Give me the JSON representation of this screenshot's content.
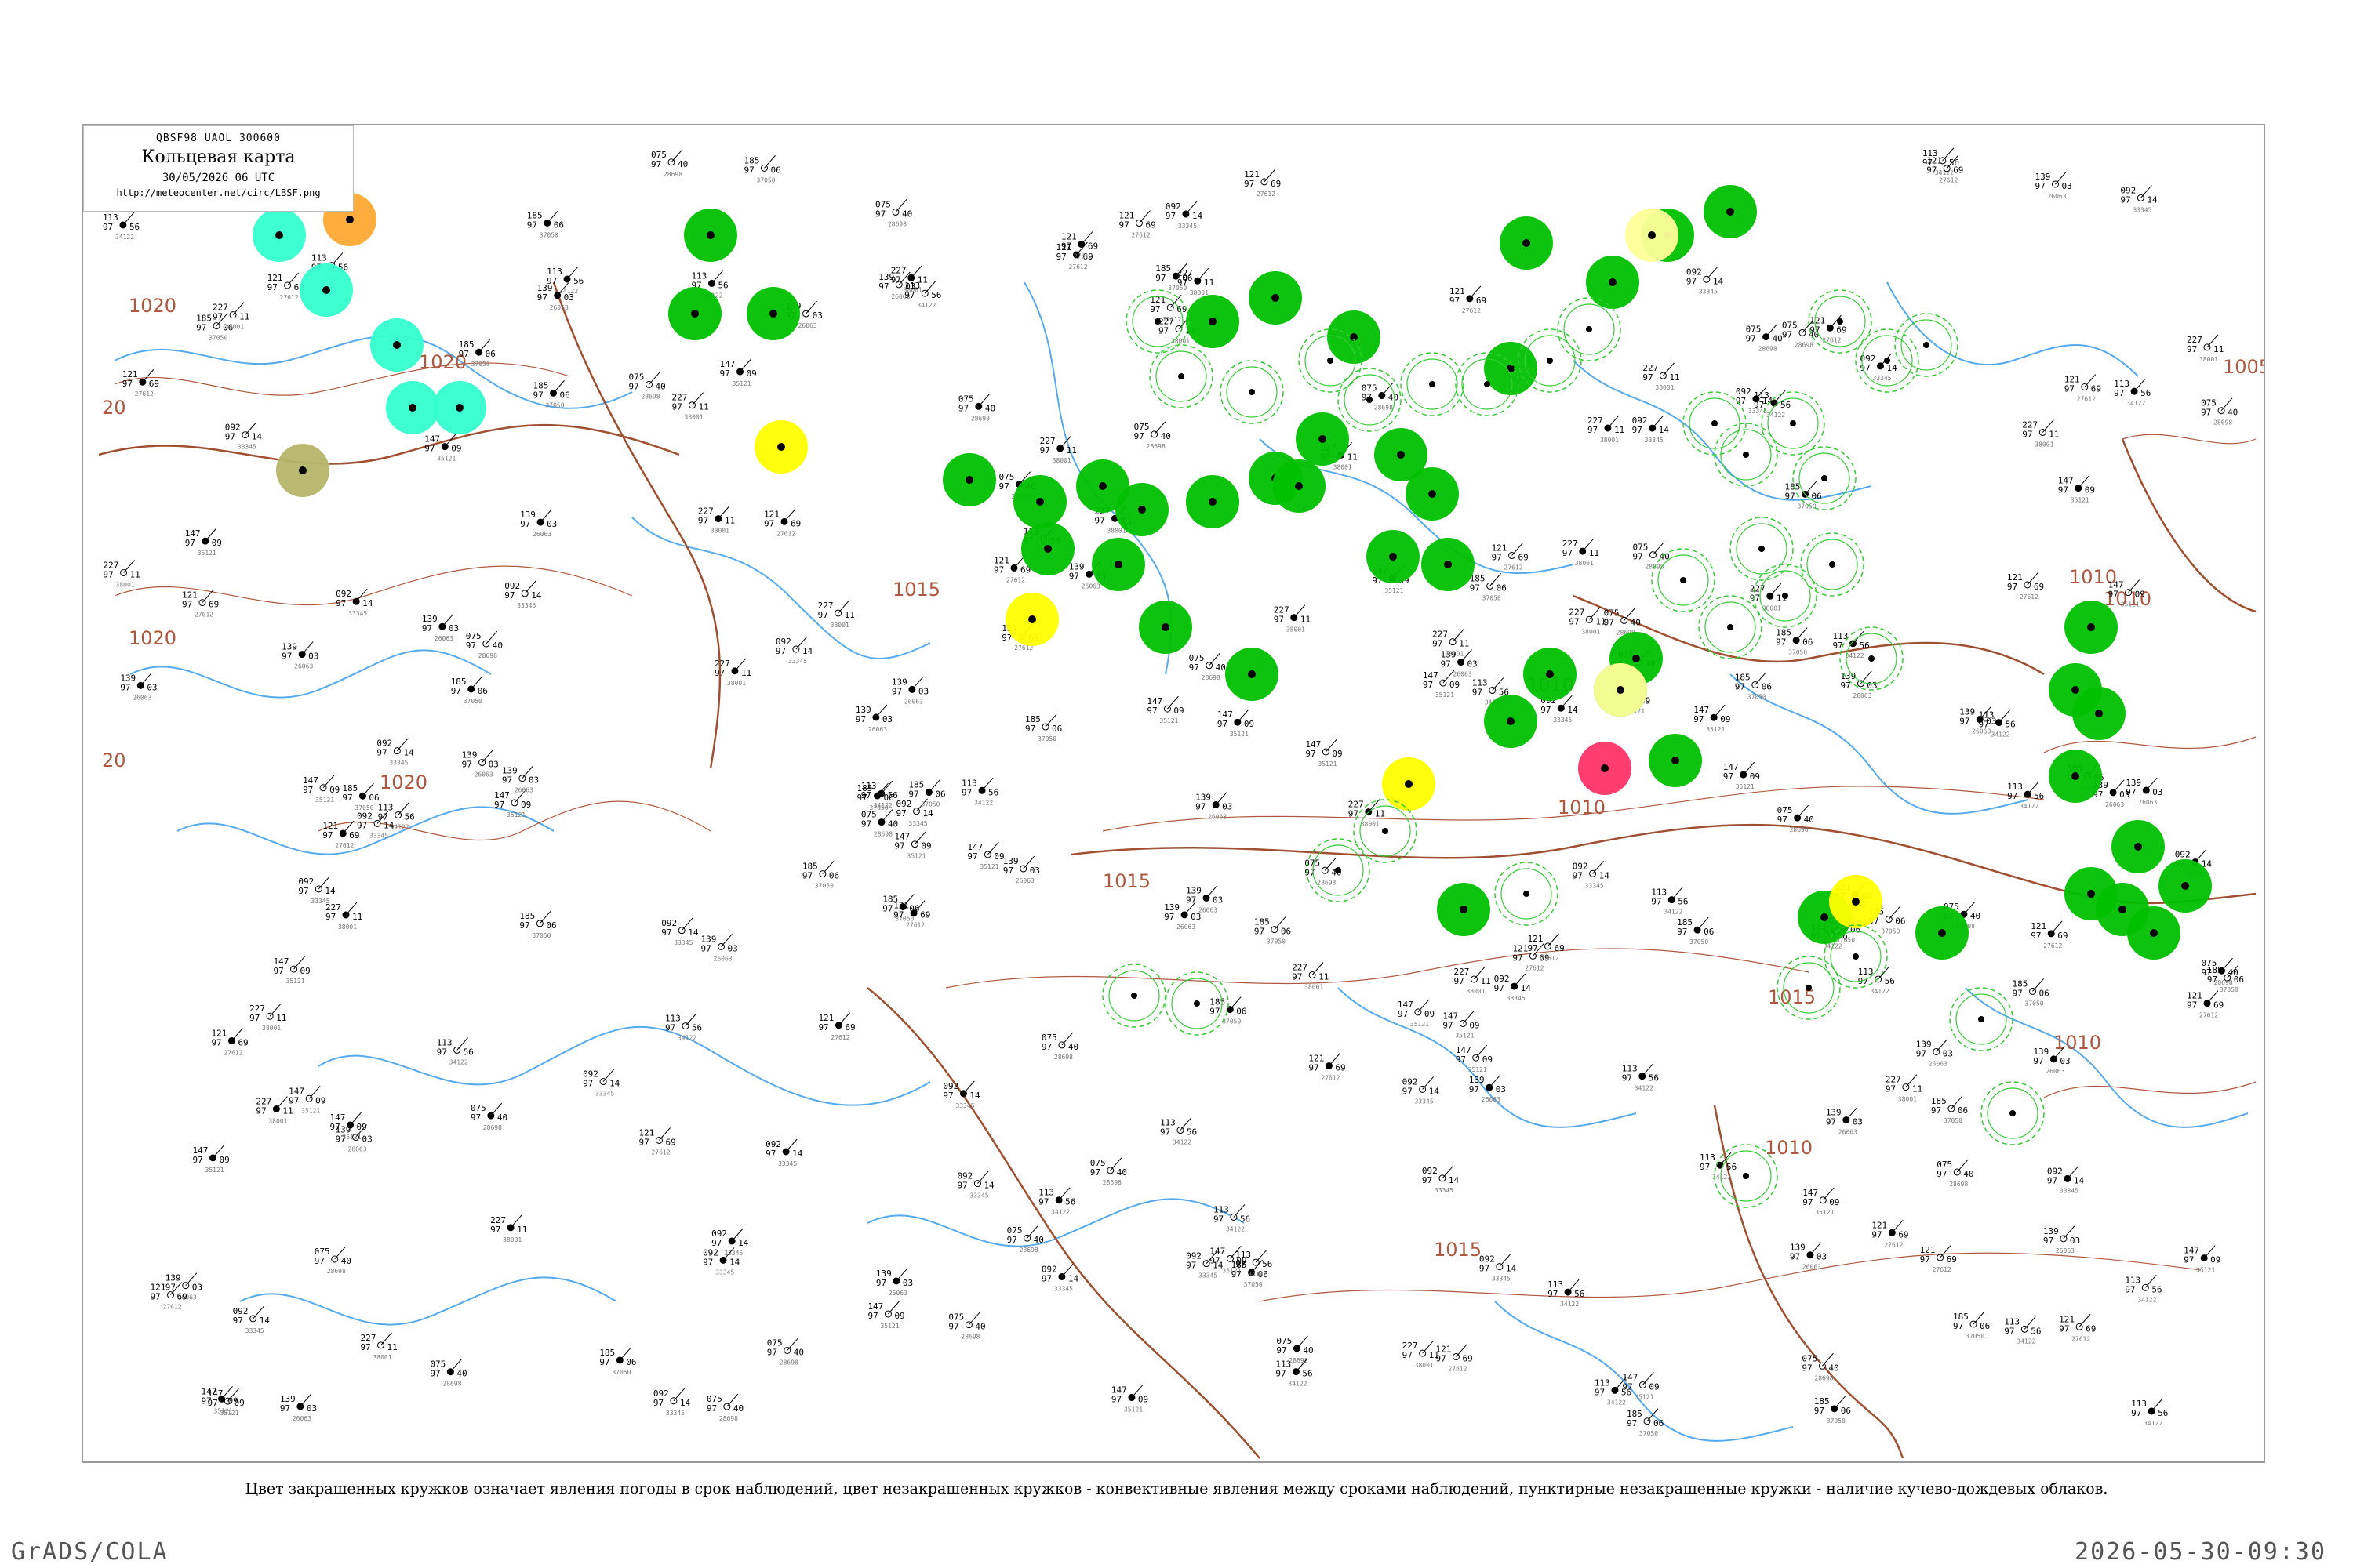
{
  "header": {
    "code": "QBSF98  UAOL  300600",
    "title": "Кольцевая карта",
    "datetime": "30/05/2026 06 UTC",
    "url": "http://meteocenter.net/circ/LBSF.png"
  },
  "caption": "Цвет закрашенных кружков означает явления погоды в срок наблюдений, цвет незакрашенных кружков - конвективные явления между сроками наблюдений, пунктирные незакрашенные кружки - наличие кучево-дождевых облаков.",
  "footer": {
    "left": "GrADS/COLA",
    "right": "2026-05-30-09:30"
  },
  "colors": {
    "green": "#00c000",
    "yellow": "#ffff00",
    "red": "#ff3366",
    "cyan": "#33ffcc",
    "orange": "#ffaa33",
    "olive": "#b5b56a",
    "pale_yellow": "#ffff99",
    "isobar": "#b0573f",
    "border": "#a05030",
    "water": "#55aaee"
  },
  "isobar_labels": [
    "1020",
    "1020",
    "1020",
    "1020",
    "20",
    "20",
    "1010",
    "1010",
    "1010",
    "1010",
    "1010",
    "1015",
    "1015",
    "1015",
    "1015",
    "1005",
    "1010"
  ],
  "filled_circles_green": 44,
  "filled_circles_yellow": 4,
  "filled_circles_red": 1,
  "filled_circles_cyan": 5,
  "filled_circles_orange": 1,
  "filled_circles_olive": 1,
  "stations_sample": [
    {
      "id": "26063",
      "values": [
        "139",
        "97",
        "03"
      ]
    },
    {
      "id": "27612",
      "values": [
        "121",
        "97",
        "69"
      ]
    },
    {
      "id": "33345",
      "values": [
        "092",
        "97",
        "14"
      ]
    },
    {
      "id": "34122",
      "values": [
        "113",
        "97",
        "56"
      ]
    },
    {
      "id": "28698",
      "values": [
        "075",
        "97",
        "40"
      ]
    },
    {
      "id": "35121",
      "values": [
        "147",
        "97",
        "09"
      ]
    },
    {
      "id": "37050",
      "values": [
        "185",
        "97",
        "06"
      ]
    },
    {
      "id": "38001",
      "values": [
        "227",
        "97",
        "11"
      ]
    }
  ]
}
